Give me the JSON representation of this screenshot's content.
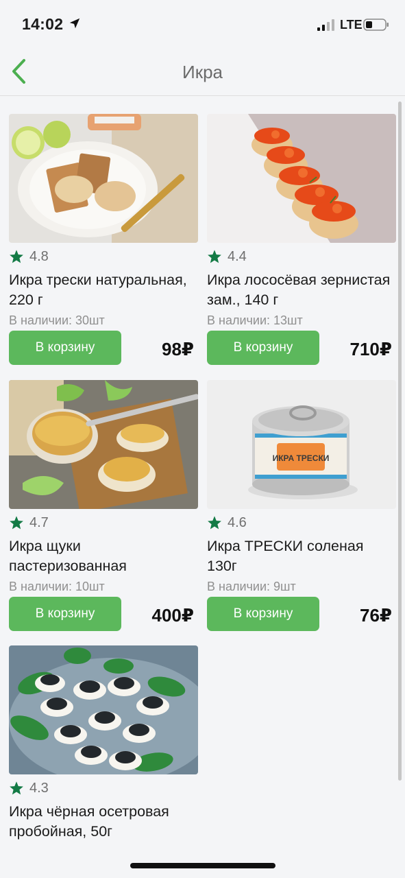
{
  "status_bar": {
    "time": "14:02",
    "network": "LTE",
    "icons": [
      "location-arrow-icon",
      "signal-icon",
      "battery-icon"
    ]
  },
  "nav": {
    "title": "Икра",
    "back_icon": "chevron-left-icon"
  },
  "colors": {
    "accent": "#5cb85c",
    "star": "#137a45",
    "background": "#f4f5f7"
  },
  "products": [
    {
      "rating": "4.8",
      "name": "Икра трески натуральная, 220 г",
      "stock": "В наличии: 30шт",
      "button": "В корзину",
      "price": "98₽"
    },
    {
      "rating": "4.4",
      "name": "Икра лососёвая зернистая зам., 140 г",
      "stock": "В наличии: 13шт",
      "button": "В корзину",
      "price": "710₽"
    },
    {
      "rating": "4.7",
      "name": "Икра щуки пастеризованная",
      "stock": "В наличии: 10шт",
      "button": "В корзину",
      "price": "400₽"
    },
    {
      "rating": "4.6",
      "name": "Икра ТРЕСКИ соленая 130г",
      "stock": "В наличии: 9шт",
      "button": "В корзину",
      "price": "76₽",
      "image_label": "ИКРА ТРЕСКИ"
    },
    {
      "rating": "4.3",
      "name": "Икра чёрная осетровая пробойная, 50г"
    }
  ]
}
